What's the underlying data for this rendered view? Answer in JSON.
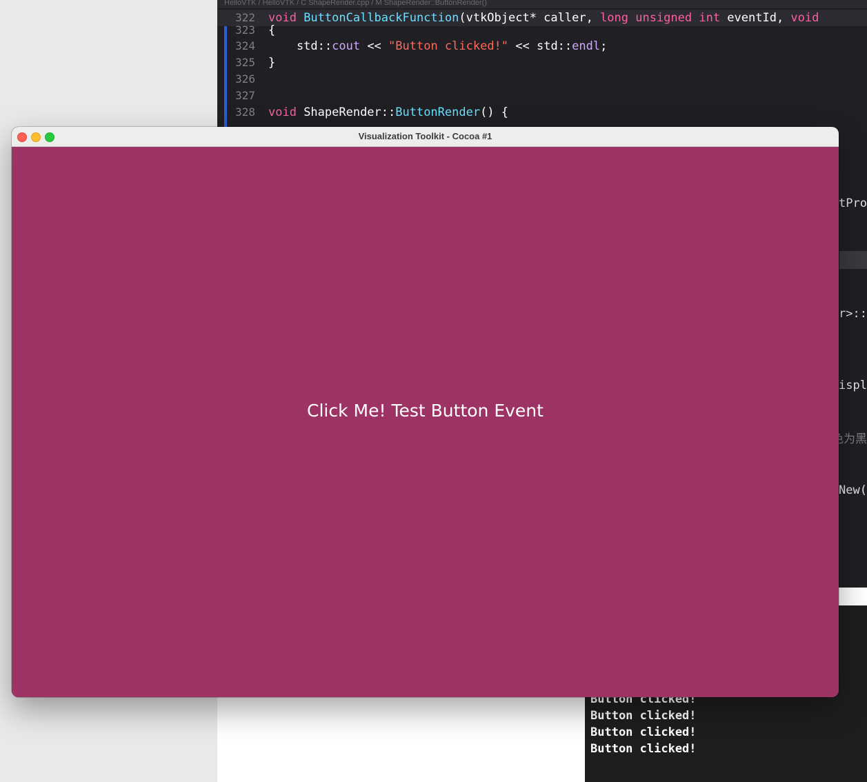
{
  "editor": {
    "breadcrumb": "HelloVTK  /  HelloVTK  /  C  ShapeRender.cpp  /  M  ShapeRender::ButtonRender()",
    "lines": [
      {
        "num": "322",
        "tokens": [
          [
            "kw",
            "void "
          ],
          [
            "fn2",
            "ButtonCallbackFunction"
          ],
          [
            "plain",
            "(vtkObject* caller, "
          ],
          [
            "kw",
            "long unsigned int "
          ],
          [
            "plain",
            "eventId, "
          ],
          [
            "kw",
            "void"
          ]
        ]
      },
      {
        "num": "323",
        "tokens": [
          [
            "plain",
            "{"
          ]
        ]
      },
      {
        "num": "324",
        "tokens": [
          [
            "plain",
            "    std::"
          ],
          [
            "id",
            "cout"
          ],
          [
            "plain",
            " << "
          ],
          [
            "str",
            "\"Button clicked!\""
          ],
          [
            "plain",
            " << std::"
          ],
          [
            "id",
            "endl"
          ],
          [
            "plain",
            ";"
          ]
        ]
      },
      {
        "num": "325",
        "tokens": [
          [
            "plain",
            "}"
          ]
        ]
      },
      {
        "num": "326",
        "tokens": []
      },
      {
        "num": "327",
        "tokens": []
      },
      {
        "num": "328",
        "tokens": [
          [
            "kw",
            "void "
          ],
          [
            "plain",
            "ShapeRender::"
          ],
          [
            "fn2",
            "ButtonRender"
          ],
          [
            "plain",
            "() {"
          ]
        ]
      }
    ],
    "peek_fragments": [
      "tPro",
      "or>::",
      "ispl",
      "色为黑",
      "New("
    ]
  },
  "console": {
    "lines": [
      "Button clicked!",
      "Button clicked!",
      "Button clicked!",
      "Button clicked!"
    ]
  },
  "vtk_window": {
    "title": "Visualization Toolkit - Cocoa #1",
    "button_text": "Click Me! Test Button Event",
    "background_color": "#9c3364"
  }
}
